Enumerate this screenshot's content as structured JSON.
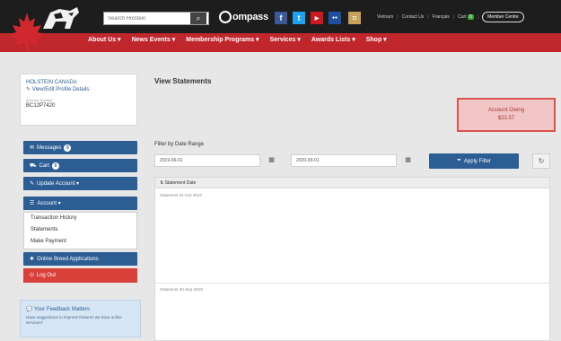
{
  "header": {
    "search_placeholder": "Search Holstein",
    "search_button_icon": "search-icon",
    "compass_label": "ompass",
    "social": [
      {
        "name": "facebook",
        "glyph": "f",
        "color": "#3b5998"
      },
      {
        "name": "twitter",
        "glyph": "t",
        "color": "#1da1f2"
      },
      {
        "name": "youtube",
        "glyph": "▶",
        "color": "#cc181e"
      },
      {
        "name": "flickr",
        "glyph": "●●",
        "color": "#1f4fa1"
      },
      {
        "name": "instagram",
        "glyph": "◘",
        "color": "#c8a15a"
      }
    ],
    "toplinks": [
      "Vietnam",
      "Contact Us",
      "Français"
    ],
    "cart_label": "Cart",
    "cart_count": "0",
    "member_button": "Member Centre",
    "nav": [
      "About Us ▾",
      "News Events ▾",
      "Membership Programs ▾",
      "Services ▾",
      "Awards Lists ▾",
      "Shop ▾"
    ]
  },
  "sidebar": {
    "org_name": "HOLSTEIN CANADA",
    "edit_profile": "View/Edit Profile Details",
    "account_label": "Account Number",
    "account_number": "BC12P7420",
    "buttons": [
      {
        "icon": "envelope-icon",
        "glyph": "✉",
        "label": "Messages",
        "count": "0"
      },
      {
        "icon": "cart-icon",
        "glyph": "🛒",
        "label": "Cart",
        "count": "0"
      },
      {
        "icon": "pencil-icon",
        "glyph": "✎",
        "label": "Update Account ▾",
        "count": ""
      },
      {
        "icon": "list-icon",
        "glyph": "☰",
        "label": "Account ▾",
        "count": ""
      }
    ],
    "account_menu": [
      "Transaction History",
      "Statements",
      "Make Payment"
    ],
    "online_applications": "Online Breed Applications",
    "logout": "Log Out",
    "feedback_title": "Your Feedback Matters",
    "feedback_text": "Have suggestions to improve features we have online services?"
  },
  "main": {
    "title": "View Statements",
    "owing_label": "Account Owing",
    "owing_amount": "$23.57",
    "filter_label": "Filter by Date Range",
    "date_from": "2019-06-01",
    "date_to": "2020-09-01",
    "apply_label": "Apply Filter",
    "table_header": "Statement Date",
    "rows": [
      "Statement 31-Oct-2019",
      "Statement 30-Sep-2019"
    ]
  },
  "colors": {
    "header_bg": "#1d1d1d",
    "nav_red": "#c0272d",
    "primary_blue": "#2c5d93",
    "danger": "#d9403a"
  }
}
